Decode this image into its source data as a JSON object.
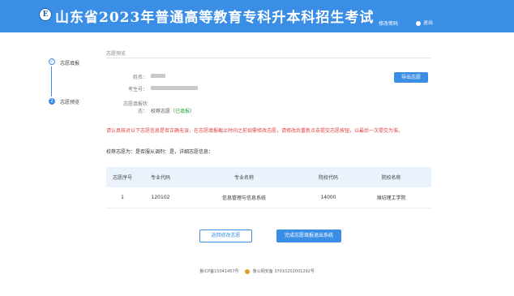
{
  "header": {
    "logo_glyph": "E",
    "title": "山东省2023年普通高等教育专科升本科招生考试",
    "change_password": "修改密码",
    "logout": "退出"
  },
  "steps": [
    {
      "label": "志愿填报",
      "marker": "✓"
    },
    {
      "label": "志愿预览",
      "marker": "2"
    }
  ],
  "section_title": "志愿预览",
  "info": {
    "name_label": "姓名：",
    "exam_no_label": "考生号：",
    "status_label_1": "志愿填报状",
    "status_label_2": "态：",
    "status_prefix": "校荐志愿（",
    "status_value": "已填报",
    "status_suffix": "）"
  },
  "export_button": "导出志愿",
  "warning": "请认真核对以下志愿信息是否正确无误，在志愿填报截止时间之前如需修改志愿，请修改后重新点击提交志愿按钮，以最后一次提交为准。",
  "summary": "校荐志愿为：是否服从调剂：是，详细志愿信息：",
  "table": {
    "headers": [
      "志愿序号",
      "专业代码",
      "专业名称",
      "院校代码",
      "院校名称"
    ],
    "rows": [
      [
        "1",
        "120102",
        "信息管理与信息系统",
        "14000",
        "潍坊理工学院"
      ]
    ]
  },
  "buttons": {
    "back": "返回修改志愿",
    "submit": "完成志愿填报退出系统"
  },
  "footer": {
    "icp": "鲁ICP备15041457号",
    "police": "鲁公网安备 37010202001292号"
  },
  "colors": {
    "primary": "#3a8ee6",
    "warning": "#e04040",
    "success": "#22a33a"
  }
}
